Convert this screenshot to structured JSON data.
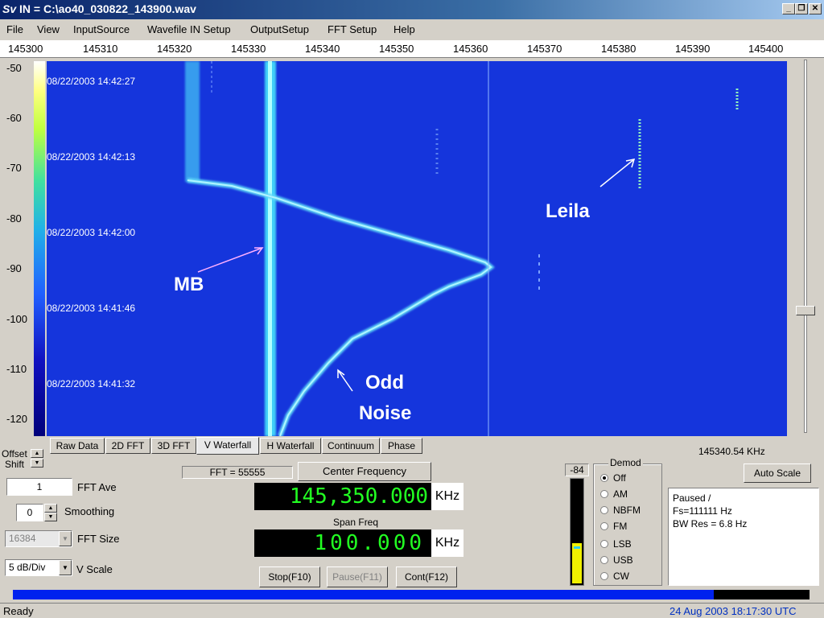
{
  "window": {
    "title": "IN = C:\\ao40_030822_143900.wav",
    "logo": "Sv"
  },
  "menu": [
    "File",
    "View",
    "InputSource",
    "Wavefile IN Setup",
    "OutputSetup",
    "FFT Setup",
    "Help"
  ],
  "freq_axis": [
    "145300",
    "145310",
    "145320",
    "145330",
    "145340",
    "145350",
    "145360",
    "145370",
    "145380",
    "145390",
    "145400"
  ],
  "db_axis": [
    "-50",
    "-60",
    "-70",
    "-80",
    "-90",
    "-100",
    "-110",
    "-120"
  ],
  "timestamps": [
    "08/22/2003 14:42:27",
    "08/22/2003 14:42:13",
    "08/22/2003 14:42:00",
    "08/22/2003 14:41:46",
    "08/22/2003 14:41:32"
  ],
  "annotations": {
    "leila": "Leila",
    "mb": "MB",
    "odd": "Odd",
    "noise": "Noise"
  },
  "tabs": [
    "Raw Data",
    "2D FFT",
    "3D FFT",
    "V Waterfall",
    "H Waterfall",
    "Continuum",
    "Phase"
  ],
  "cursor_freq": "145340.54 KHz",
  "auto_scale": "Auto Scale",
  "offset_label": "Offset",
  "shift_label": "Shift",
  "fft_ave": {
    "value": "1",
    "label": "FFT Ave"
  },
  "smoothing": {
    "value": "0",
    "label": "Smoothing"
  },
  "fft_size": {
    "value": "16384",
    "label": "FFT Size"
  },
  "vscale": {
    "value": "5 dB/Div",
    "label": "V Scale"
  },
  "fft_count": "FFT = 55555",
  "center_freq_button": "Center Frequency",
  "center_freq": {
    "value": "145,350.000",
    "unit": "KHz"
  },
  "span_label": "Span Freq",
  "span_freq": {
    "value": "100.000",
    "unit": "KHz"
  },
  "buttons": {
    "stop": "Stop(F10)",
    "pause": "Pause(F11)",
    "cont": "Cont(F12)"
  },
  "level": "-84",
  "demod": {
    "title": "Demod",
    "options": [
      "Off",
      "AM",
      "NBFM",
      "FM",
      "LSB",
      "USB",
      "CW"
    ],
    "selected": "Off"
  },
  "status_box": [
    "Paused  /",
    "Fs=111111 Hz",
    "BW Res =  6.8 Hz"
  ],
  "progress": 0.88,
  "statusbar": {
    "left": "Ready",
    "right": "24 Aug 2003   18:17:30 UTC"
  }
}
